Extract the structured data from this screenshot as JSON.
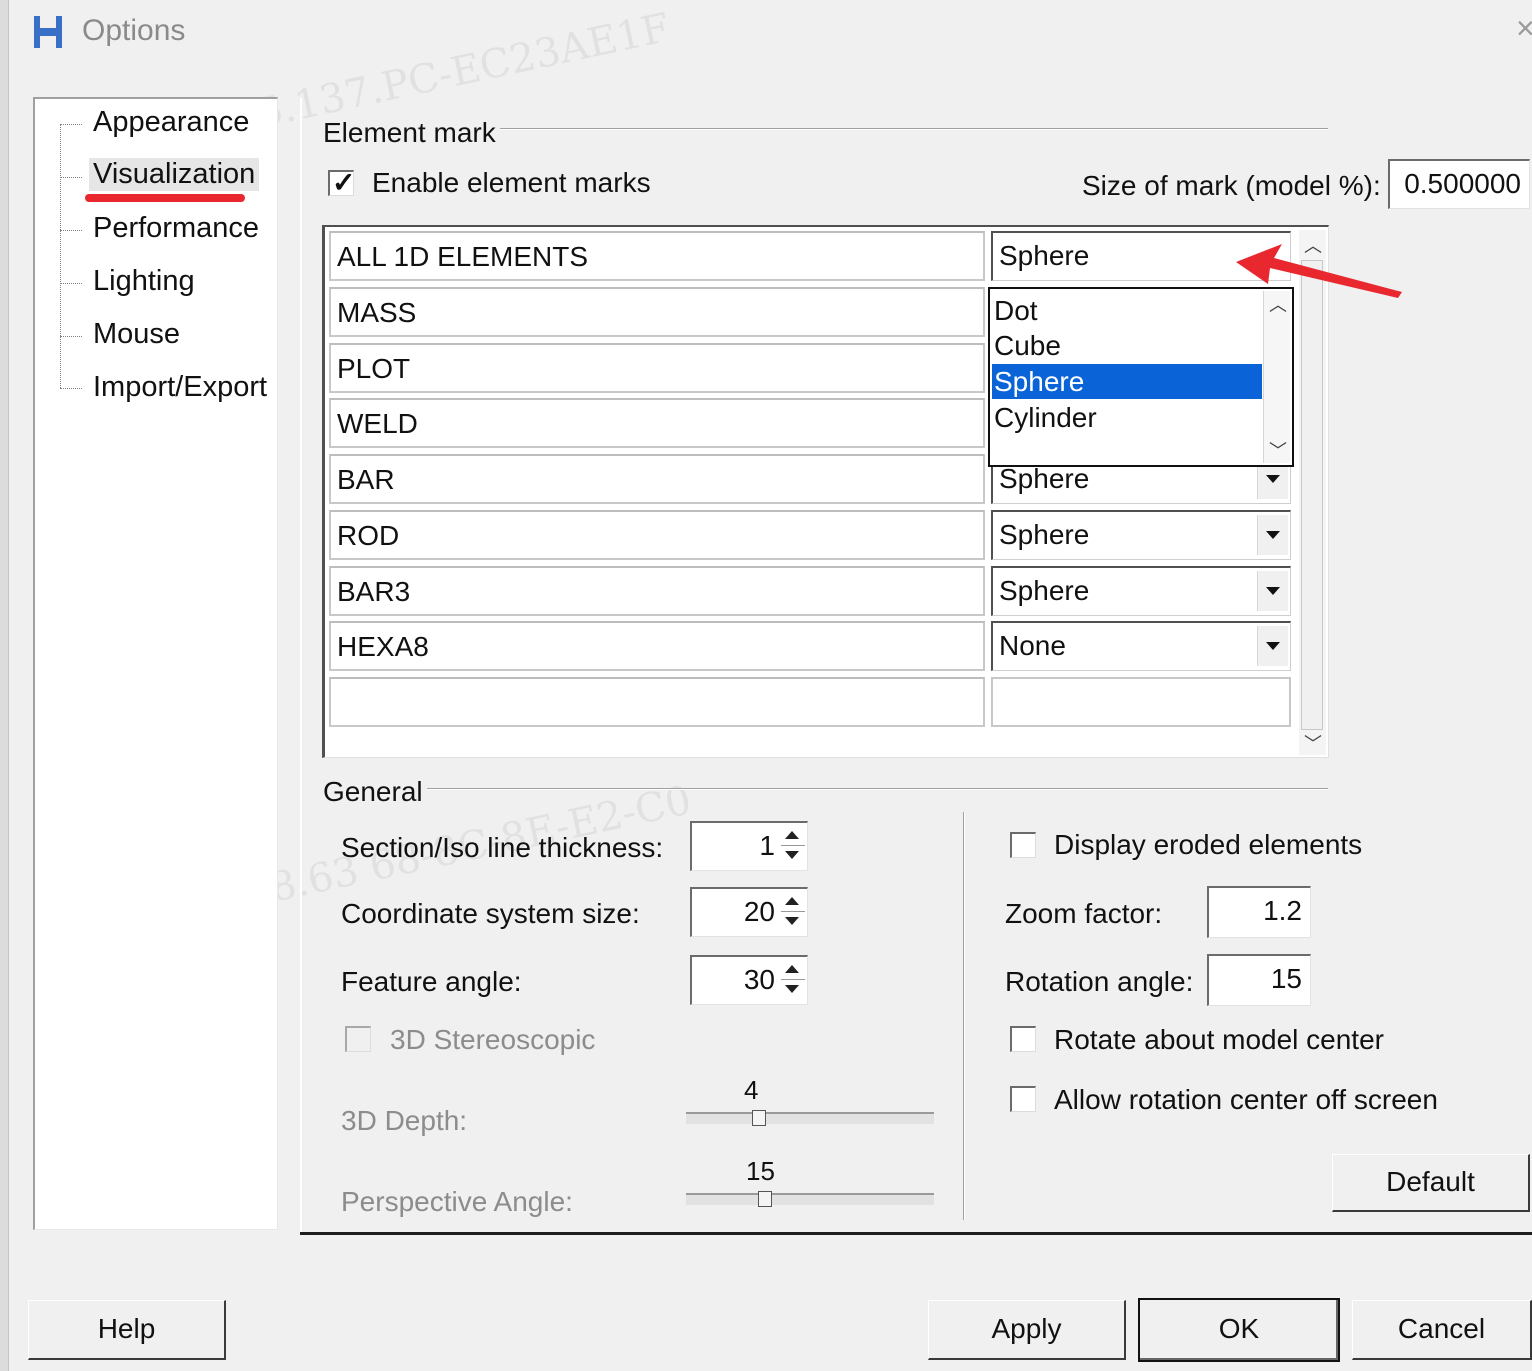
{
  "window": {
    "title": "Options",
    "close_glyph": "×"
  },
  "tree": {
    "items": [
      {
        "label": "Appearance"
      },
      {
        "label": "Visualization",
        "selected": true
      },
      {
        "label": "Performance"
      },
      {
        "label": "Lighting"
      },
      {
        "label": "Mouse"
      },
      {
        "label": "Import/Export"
      }
    ]
  },
  "element_mark": {
    "group_label": "Element mark",
    "enable_label": "Enable element marks",
    "enable_checked": true,
    "size_label": "Size of mark (model %):",
    "size_value": "0.500000",
    "rows": [
      {
        "name": "ALL 1D ELEMENTS",
        "mark": "Sphere"
      },
      {
        "name": "MASS",
        "mark": ""
      },
      {
        "name": "PLOT",
        "mark": ""
      },
      {
        "name": "WELD",
        "mark": ""
      },
      {
        "name": "BAR",
        "mark": "Sphere"
      },
      {
        "name": "ROD",
        "mark": "Sphere"
      },
      {
        "name": "BAR3",
        "mark": "Sphere"
      },
      {
        "name": "HEXA8",
        "mark": "None"
      }
    ],
    "dropdown_options": [
      "Dot",
      "Cube",
      "Sphere",
      "Cylinder"
    ],
    "dropdown_selected": "Sphere"
  },
  "general": {
    "group_label": "General",
    "section_iso_label": "Section/Iso line thickness:",
    "section_iso_value": "1",
    "coord_size_label": "Coordinate system size:",
    "coord_size_value": "20",
    "feature_angle_label": "Feature angle:",
    "feature_angle_value": "30",
    "stereo_label": "3D Stereoscopic",
    "depth_label": "3D Depth:",
    "depth_value": "4",
    "perspective_label": "Perspective Angle:",
    "perspective_value": "15",
    "display_eroded_label": "Display eroded elements",
    "zoom_label": "Zoom factor:",
    "zoom_value": "1.2",
    "rotation_label": "Rotation angle:",
    "rotation_value": "15",
    "rotate_center_label": "Rotate about model center",
    "allow_offscreen_label": "Allow rotation center off screen",
    "default_button": "Default"
  },
  "footer": {
    "help": "Help",
    "apply": "Apply",
    "ok": "OK",
    "cancel": "Cancel"
  },
  "colors": {
    "selection_blue": "#0a64d8",
    "annotation_red": "#e8282e",
    "dialog_bg": "#f0f0f0"
  }
}
